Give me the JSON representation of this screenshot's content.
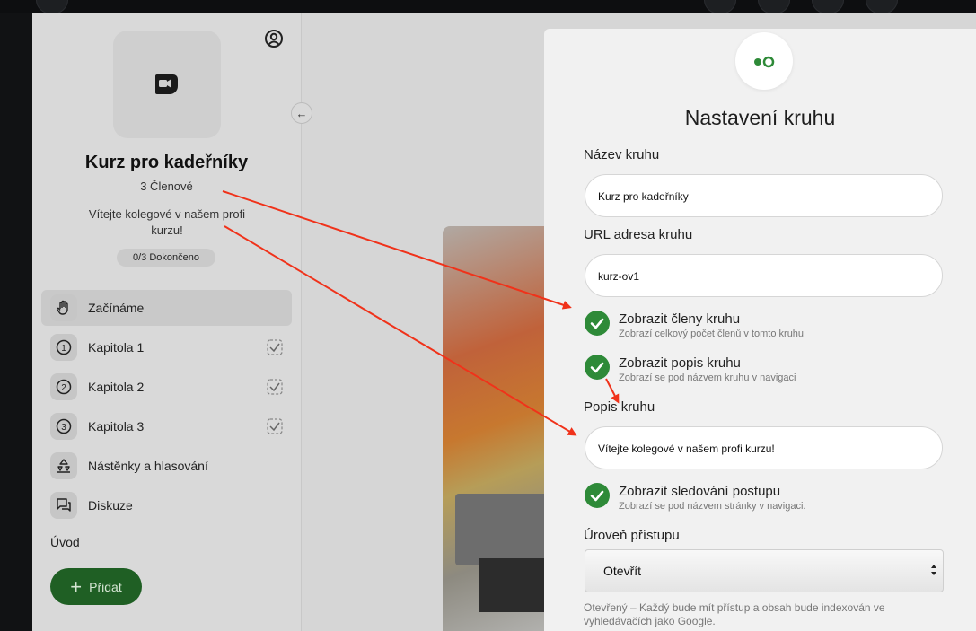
{
  "colors": {
    "accent_green": "#2e8a38",
    "annotation_red": "#f0321a",
    "add_button": "#1f5f24"
  },
  "sidebar": {
    "group_title": "Kurz pro kadeřníky",
    "members": "3 Členové",
    "description": "Vítejte kolegové v našem profi kurzu!",
    "progress": "0/3 Dokončeno",
    "items": [
      {
        "label": "Začínáme",
        "icon": "hand-icon",
        "active": true
      },
      {
        "label": "Kapitola 1",
        "icon": "number-1-icon",
        "completed_check": true
      },
      {
        "label": "Kapitola 2",
        "icon": "number-2-icon",
        "completed_check": true
      },
      {
        "label": "Kapitola 3",
        "icon": "number-3-icon",
        "completed_check": true
      },
      {
        "label": "Nástěnky a hlasování",
        "icon": "poll-icon"
      },
      {
        "label": "Diskuze",
        "icon": "chat-icon"
      }
    ],
    "section_label": "Úvod",
    "add_button_label": "Přidat"
  },
  "settings": {
    "title": "Nastavení kruhu",
    "name_label": "Název kruhu",
    "name_value": "Kurz pro kadeřníky",
    "url_label": "URL adresa kruhu",
    "url_value": "kurz-ov1",
    "toggles": [
      {
        "title": "Zobrazit členy kruhu",
        "subtitle": "Zobrazí celkový počet členů v tomto kruhu",
        "checked": true
      },
      {
        "title": "Zobrazit popis kruhu",
        "subtitle": "Zobrazí se pod názvem kruhu v navigaci",
        "checked": true
      },
      {
        "title": "Zobrazit sledování postupu",
        "subtitle": "Zobrazí se pod názvem stránky v navigaci.",
        "checked": true
      }
    ],
    "description_label": "Popis kruhu",
    "description_value": "Vítejte kolegové v našem profi kurzu!",
    "access_label": "Úroveň přístupu",
    "access_value": "Otevřít",
    "access_help": "Otevřený – Každý bude mít přístup a obsah bude indexován ve vyhledávačích jako Google."
  }
}
